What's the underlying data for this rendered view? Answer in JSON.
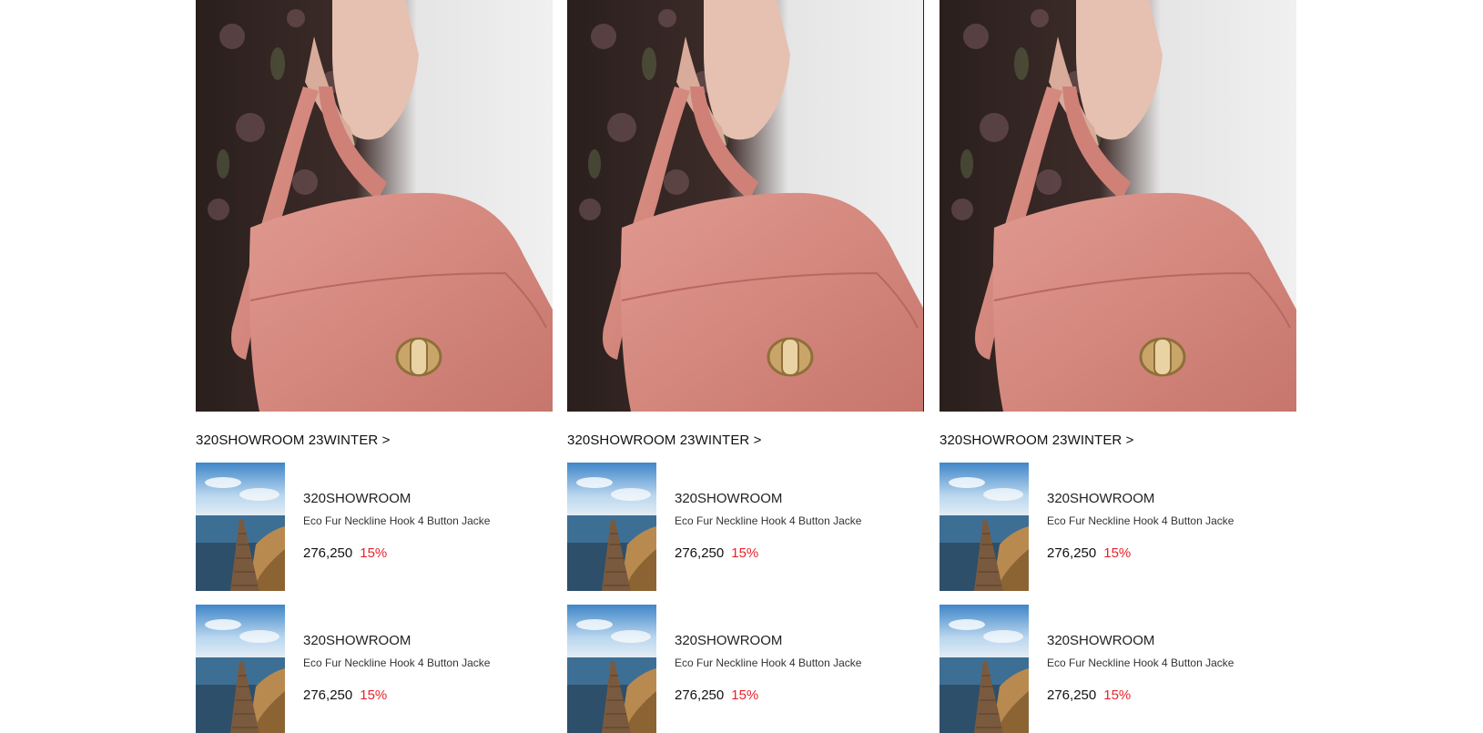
{
  "columns": [
    {
      "hero_alt": "pink handbag",
      "title": "320SHOWROOM 23WINTER >",
      "products": [
        {
          "brand": "320SHOWROOM",
          "name": "Eco Fur Neckline Hook 4 Button Jacke",
          "price": "276,250",
          "discount": "15%"
        },
        {
          "brand": "320SHOWROOM",
          "name": "Eco Fur Neckline Hook 4 Button Jacke",
          "price": "276,250",
          "discount": "15%"
        }
      ]
    },
    {
      "hero_alt": "pink handbag",
      "title": "320SHOWROOM 23WINTER >",
      "products": [
        {
          "brand": "320SHOWROOM",
          "name": "Eco Fur Neckline Hook 4 Button Jacke",
          "price": "276,250",
          "discount": "15%"
        },
        {
          "brand": "320SHOWROOM",
          "name": "Eco Fur Neckline Hook 4 Button Jacke",
          "price": "276,250",
          "discount": "15%"
        }
      ]
    },
    {
      "hero_alt": "pink handbag",
      "title": "320SHOWROOM 23WINTER >",
      "products": [
        {
          "brand": "320SHOWROOM",
          "name": "Eco Fur Neckline Hook 4 Button Jacke",
          "price": "276,250",
          "discount": "15%"
        },
        {
          "brand": "320SHOWROOM",
          "name": "Eco Fur Neckline Hook 4 Button Jacke",
          "price": "276,250",
          "discount": "15%"
        }
      ]
    }
  ],
  "colors": {
    "discount": "#e8232a",
    "bag": "#d4877e",
    "background": "#ffffff"
  }
}
